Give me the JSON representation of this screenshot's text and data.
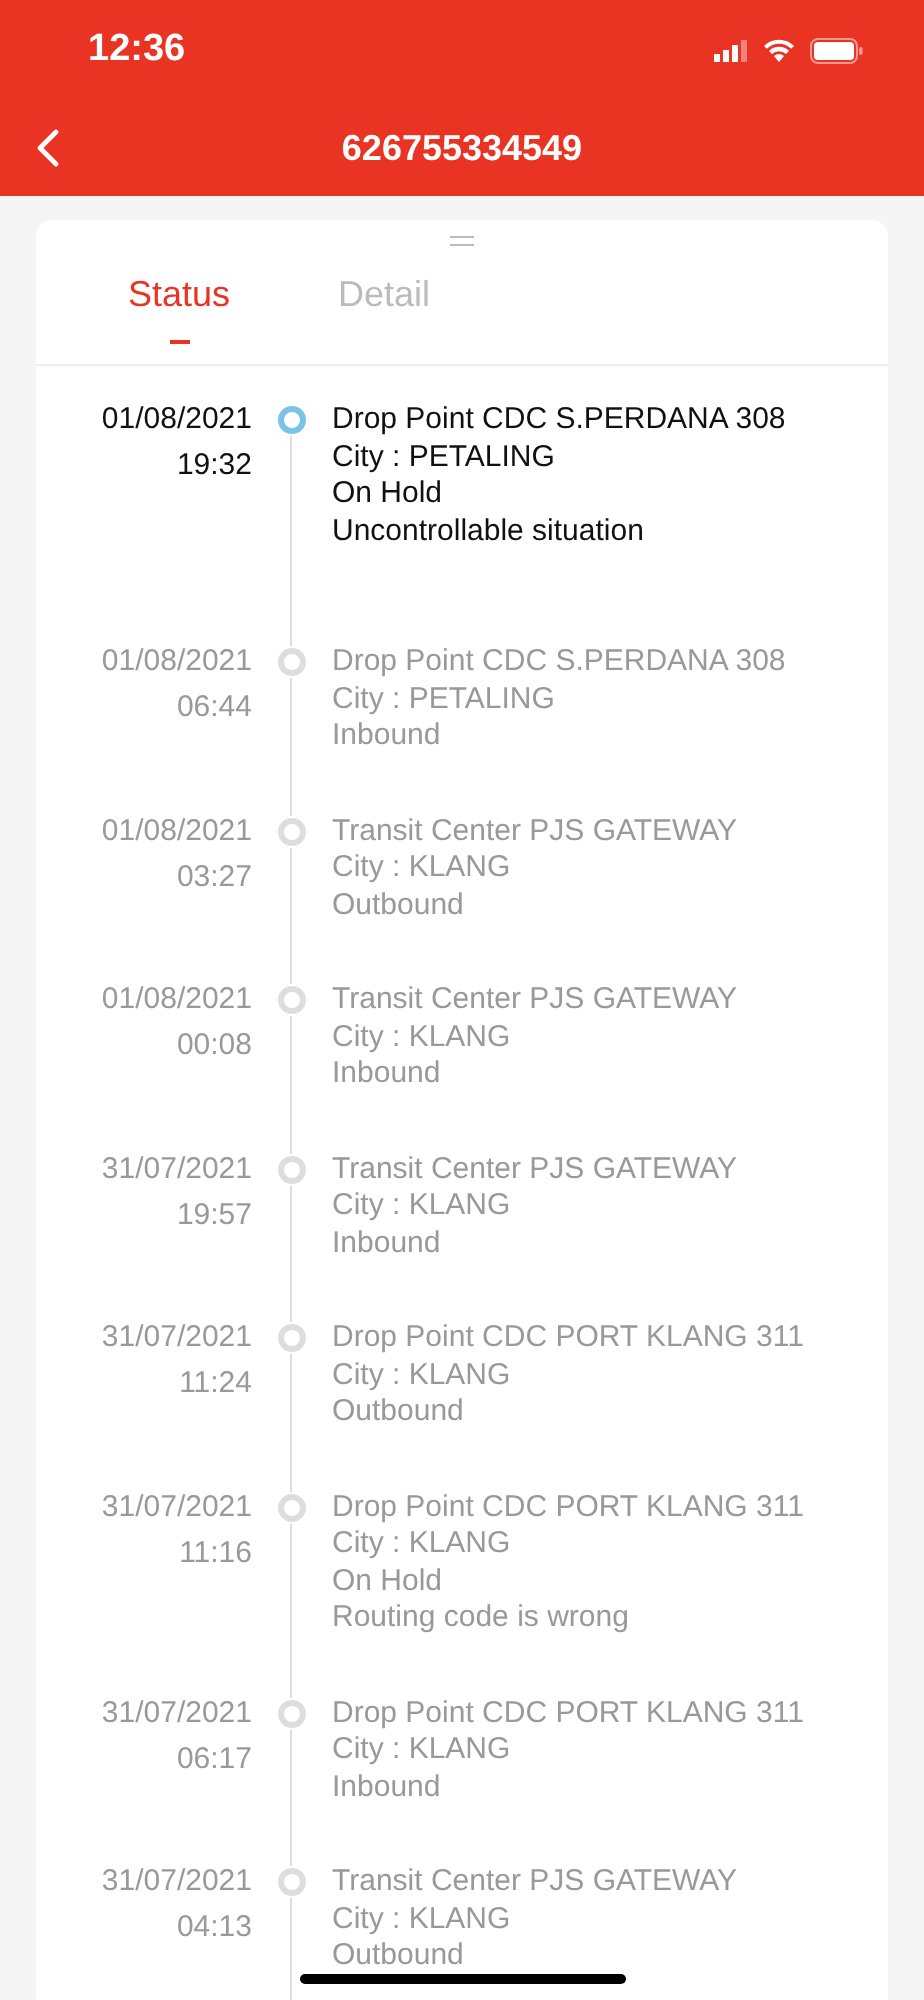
{
  "status_bar": {
    "time": "12:36"
  },
  "nav": {
    "title": "626755334549"
  },
  "tabs": [
    {
      "label": "Status",
      "selected": true
    },
    {
      "label": "Detail",
      "selected": false
    }
  ],
  "events": [
    {
      "date": "01/08/2021",
      "time": "19:32",
      "current": true,
      "lines": [
        "Drop Point CDC S.PERDANA 308",
        "City : PETALING",
        "On Hold",
        "Uncontrollable situation"
      ]
    },
    {
      "date": "01/08/2021",
      "time": "06:44",
      "current": false,
      "lines": [
        "Drop Point CDC S.PERDANA 308",
        "City : PETALING",
        "Inbound"
      ]
    },
    {
      "date": "01/08/2021",
      "time": "03:27",
      "current": false,
      "lines": [
        "Transit Center PJS GATEWAY",
        "City : KLANG",
        "Outbound"
      ]
    },
    {
      "date": "01/08/2021",
      "time": "00:08",
      "current": false,
      "lines": [
        "Transit Center PJS GATEWAY",
        "City : KLANG",
        "Inbound"
      ]
    },
    {
      "date": "31/07/2021",
      "time": "19:57",
      "current": false,
      "lines": [
        "Transit Center PJS GATEWAY",
        "City : KLANG",
        "Inbound"
      ]
    },
    {
      "date": "31/07/2021",
      "time": "11:24",
      "current": false,
      "lines": [
        "Drop Point CDC PORT KLANG 311",
        "City : KLANG",
        "Outbound"
      ]
    },
    {
      "date": "31/07/2021",
      "time": "11:16",
      "current": false,
      "lines": [
        "Drop Point CDC PORT KLANG 311",
        "City : KLANG",
        "On Hold",
        "Routing code is wrong"
      ]
    },
    {
      "date": "31/07/2021",
      "time": "06:17",
      "current": false,
      "lines": [
        "Drop Point CDC PORT KLANG 311",
        "City : KLANG",
        "Inbound"
      ]
    },
    {
      "date": "31/07/2021",
      "time": "04:13",
      "current": false,
      "lines": [
        "Transit Center PJS GATEWAY",
        "City : KLANG",
        "Outbound"
      ]
    }
  ]
}
